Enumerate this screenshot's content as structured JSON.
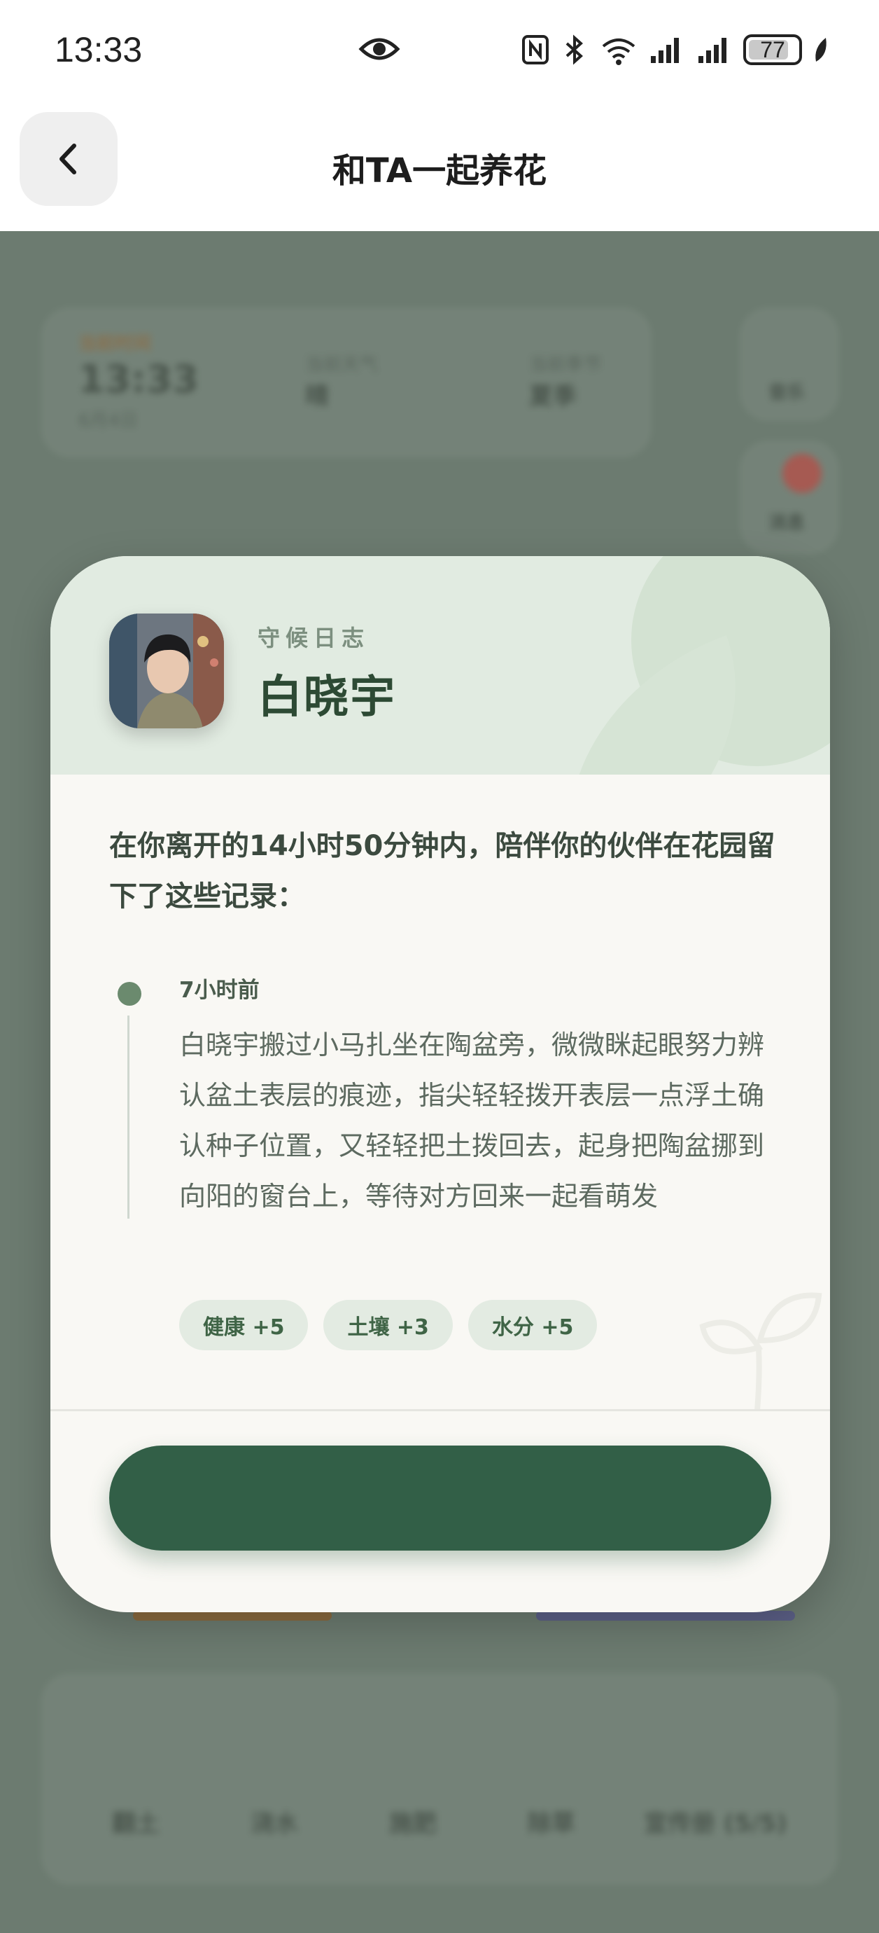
{
  "status_bar": {
    "time": "13:33",
    "battery_percent": "77",
    "icons": [
      "eye-icon",
      "nfc-icon",
      "bluetooth-icon",
      "wifi-icon",
      "signal-icon",
      "signal-icon",
      "battery-icon",
      "leaf-icon"
    ]
  },
  "nav": {
    "title": "和TA一起养花",
    "back_icon": "chevron-left-icon"
  },
  "modal": {
    "label": "守候日志",
    "partner_name": "白晓宇",
    "intro": "在你离开的14小时50分钟内，陪伴你的伙伴在花园留下了这些记录：",
    "entries": [
      {
        "time": "7小时前",
        "text": "白晓宇搬过小马扎坐在陶盆旁，微微眯起眼努力辨认盆土表层的痕迹，指尖轻轻拨开表层一点浮土确认种子位置，又轻轻把土拨回去，起身把陶盆挪到向阳的窗台上，等待对方回来一起看萌发",
        "tags": [
          "健康 +5",
          "土壤 +3",
          "水分 +5"
        ]
      }
    ],
    "button_label": ""
  },
  "background": {
    "clock_label": "当前时间",
    "clock_time": "13:33",
    "clock_date": "6月4日",
    "weather_label": "当前天气",
    "weather_value": "晴",
    "season_label": "当前季节",
    "season_value": "夏季",
    "music_label": "音乐",
    "message_label": "消息",
    "actions": [
      "翻土",
      "浇水",
      "施肥",
      "除草",
      "宣传册 (5/5)"
    ]
  },
  "colors": {
    "accent": "#325f47",
    "header_bg": "#e1ebe1",
    "modal_bg": "#f9f8f4",
    "overlay": "#6c7b70"
  }
}
